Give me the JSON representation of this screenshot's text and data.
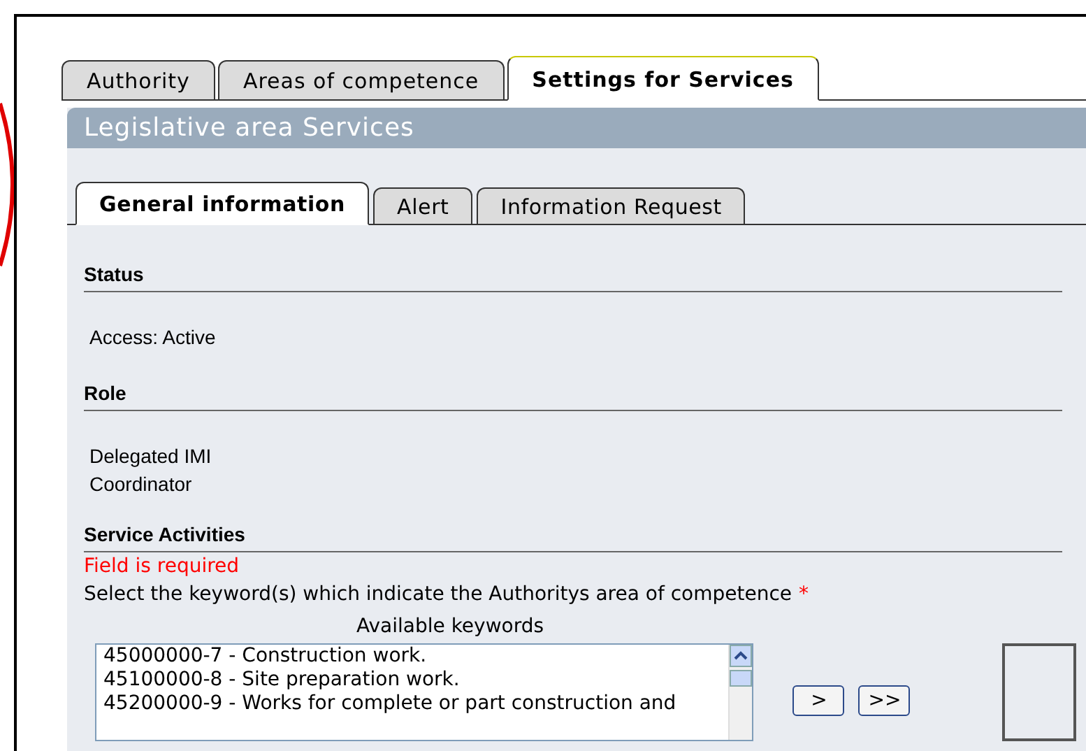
{
  "top_tabs": [
    {
      "label": "Authority",
      "selected": false
    },
    {
      "label": "Areas of competence",
      "selected": false
    },
    {
      "label": "Settings for Services",
      "selected": true
    }
  ],
  "panel_title": "Legislative area Services",
  "sub_tabs": [
    {
      "label": "General information",
      "selected": true
    },
    {
      "label": "Alert",
      "selected": false
    },
    {
      "label": "Information Request",
      "selected": false
    }
  ],
  "sections": [
    {
      "title": "Status",
      "lines": [
        "Access: Active"
      ]
    },
    {
      "title": "Role",
      "lines": [
        "Delegated IMI",
        "Coordinator"
      ]
    }
  ],
  "service_activities": {
    "title": "Service Activities",
    "error": "Field is required",
    "instruction": "Select the keyword(s) which indicate the Authoritys area of competence",
    "required_mark": "*",
    "available_label": "Available keywords",
    "keywords": [
      "45000000-7 - Construction work.",
      "45100000-8 - Site preparation work.",
      "45200000-9 - Works for complete or part construction and"
    ],
    "buttons": [
      ">",
      ">>"
    ]
  }
}
